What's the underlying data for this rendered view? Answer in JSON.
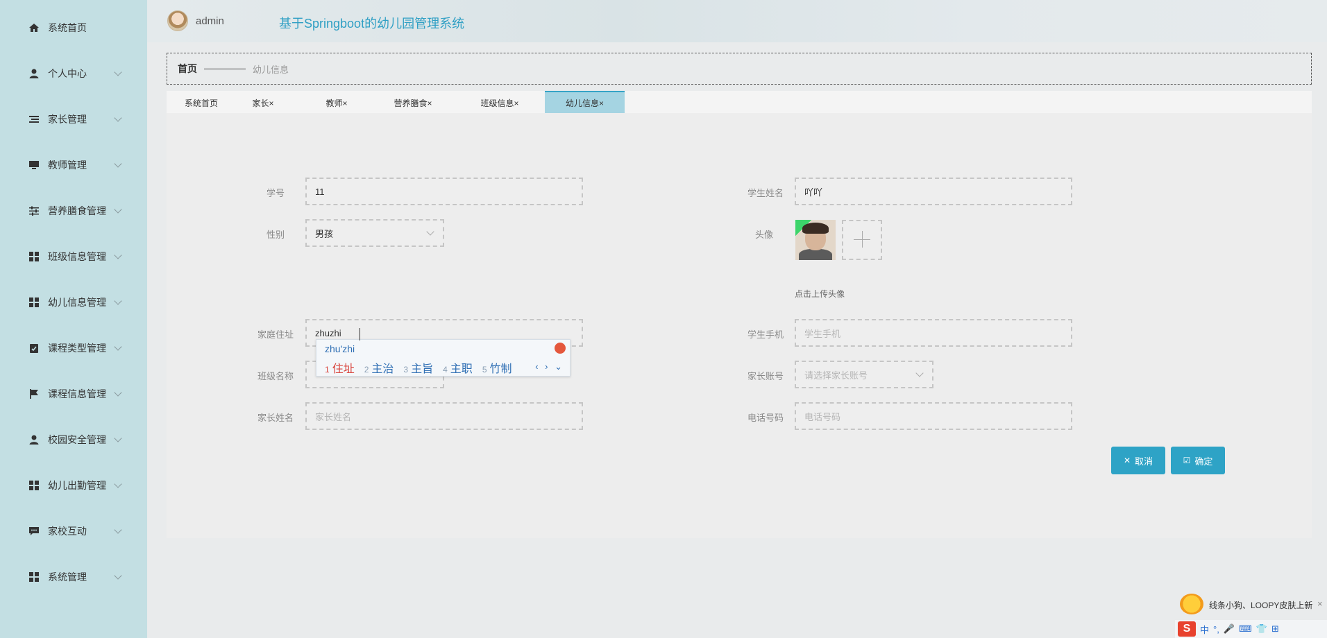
{
  "header": {
    "username": "admin",
    "title": "基于Springboot的幼儿园管理系统"
  },
  "sidebar": {
    "items": [
      {
        "label": "系统首页",
        "icon": "home-icon",
        "has_children": false
      },
      {
        "label": "个人中心",
        "icon": "user-icon",
        "has_children": true
      },
      {
        "label": "家长管理",
        "icon": "list-icon",
        "has_children": true
      },
      {
        "label": "教师管理",
        "icon": "monitor-icon",
        "has_children": true
      },
      {
        "label": "营养膳食管理",
        "icon": "sliders-icon",
        "has_children": true
      },
      {
        "label": "班级信息管理",
        "icon": "grid-icon",
        "has_children": true
      },
      {
        "label": "幼儿信息管理",
        "icon": "grid-icon",
        "has_children": true
      },
      {
        "label": "课程类型管理",
        "icon": "clipboard-icon",
        "has_children": true
      },
      {
        "label": "课程信息管理",
        "icon": "flag-icon",
        "has_children": true
      },
      {
        "label": "校园安全管理",
        "icon": "user-icon",
        "has_children": true
      },
      {
        "label": "幼儿出勤管理",
        "icon": "grid-icon",
        "has_children": true
      },
      {
        "label": "家校互动",
        "icon": "chat-icon",
        "has_children": true
      },
      {
        "label": "系统管理",
        "icon": "grid-icon",
        "has_children": true
      }
    ]
  },
  "breadcrumb": {
    "home": "首页",
    "current": "幼儿信息"
  },
  "tabs": [
    {
      "label": "系统首页"
    },
    {
      "label": "家长×"
    },
    {
      "label": "教师×"
    },
    {
      "label": "营养膳食×"
    },
    {
      "label": "班级信息×"
    },
    {
      "label": "幼儿信息×",
      "active": true
    }
  ],
  "form": {
    "student_no": {
      "label": "学号",
      "value": "11"
    },
    "student_name": {
      "label": "学生姓名",
      "value": "吖吖"
    },
    "gender": {
      "label": "性别",
      "value": "男孩"
    },
    "avatar": {
      "label": "头像",
      "hint": "点击上传头像"
    },
    "address": {
      "label": "家庭住址",
      "value": "zhuzhi"
    },
    "student_phone": {
      "label": "学生手机",
      "placeholder": "学生手机"
    },
    "class_name": {
      "label": "班级名称"
    },
    "parent_account": {
      "label": "家长账号",
      "placeholder": "请选择家长账号"
    },
    "parent_name": {
      "label": "家长姓名",
      "placeholder": "家长姓名"
    },
    "phone": {
      "label": "电话号码",
      "placeholder": "电话号码"
    },
    "cancel_label": "取消",
    "confirm_label": "确定"
  },
  "ime": {
    "pinyin": "zhu'zhi",
    "candidates": [
      {
        "num": "1",
        "text": "住址"
      },
      {
        "num": "2",
        "text": "主治"
      },
      {
        "num": "3",
        "text": "主旨"
      },
      {
        "num": "4",
        "text": "主职"
      },
      {
        "num": "5",
        "text": "竹制"
      }
    ]
  },
  "tray": {
    "notification": "线条小狗、LOOPY皮肤上新",
    "close": "×",
    "ime_mode": "中"
  },
  "colors": {
    "accent": "#2ea3c6",
    "sidebar_bg": "#c3dfe3",
    "title": "#2f9fc4"
  }
}
